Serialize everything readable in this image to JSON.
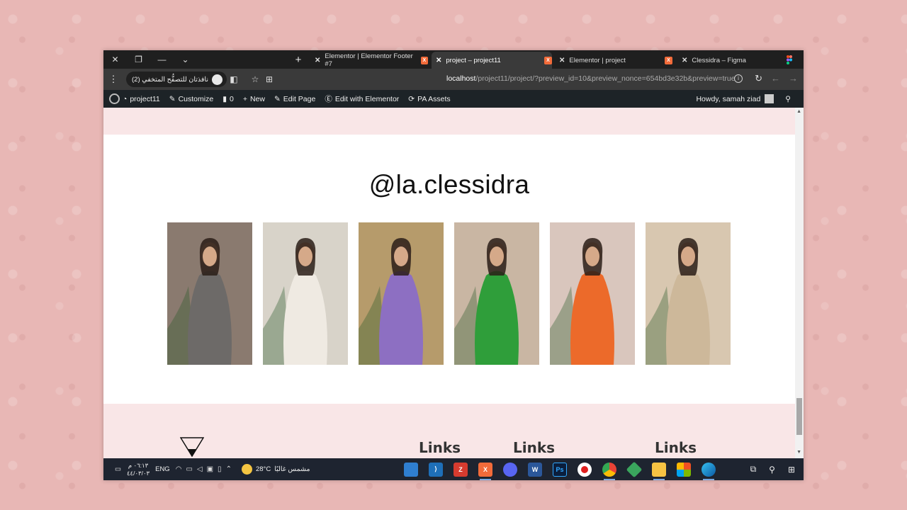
{
  "window_controls": {
    "close": "✕",
    "restore": "❐",
    "minimize": "—",
    "dropdown": "⌄"
  },
  "new_tab": "+",
  "tabs": [
    {
      "title": "Elementor | Elementor Footer #7",
      "active": false
    },
    {
      "title": "project – project11",
      "active": true
    },
    {
      "title": "Elementor | project",
      "active": false
    },
    {
      "title": "Clessidra – Figma",
      "active": false
    }
  ],
  "address_bar": {
    "incognito_label": "نافذتان للتصفُّح المتخفي (2)",
    "url_host": "localhost",
    "url_path": "/project11/project/?preview_id=10&preview_nonce=654bd3e32b&preview=true"
  },
  "admin_bar": {
    "site_name": "project11",
    "customize": "Customize",
    "comments_count": "0",
    "new": "New",
    "edit_page": "Edit Page",
    "edit_elementor": "Edit with Elementor",
    "pa_assets": "PA Assets",
    "howdy": "Howdy, samah ziad"
  },
  "page": {
    "handle": "@la.clessidra",
    "photos": [
      {
        "dress": "grey sequin cape",
        "bg": "#8a7a6f",
        "dress_color": "#6d6a68"
      },
      {
        "dress": "white dress",
        "bg": "#d8d3c9",
        "dress_color": "#efeae2"
      },
      {
        "dress": "purple dress",
        "bg": "#b69b6b",
        "dress_color": "#8d6fc2"
      },
      {
        "dress": "green dress",
        "bg": "#c9b6a3",
        "dress_color": "#2f9e3a"
      },
      {
        "dress": "orange dress",
        "bg": "#d9c6bd",
        "dress_color": "#ec6a2a"
      },
      {
        "dress": "beige lace dress",
        "bg": "#d8c7b0",
        "dress_color": "#cdb89a"
      }
    ],
    "footer_headings": [
      "Links",
      "Links",
      "Links"
    ]
  },
  "taskbar": {
    "time": "٠٦:١٣ م",
    "date": "٤٤/٠٣/٠٣",
    "language": "ENG",
    "temperature": "28°C",
    "weather_text": "مشمس غالبًا"
  },
  "colors": {
    "desktop_bg": "#e8b7b5",
    "page_band": "#f9e6e7",
    "admin_bar": "#1d2327",
    "tab_bar": "#1f1f1f"
  }
}
